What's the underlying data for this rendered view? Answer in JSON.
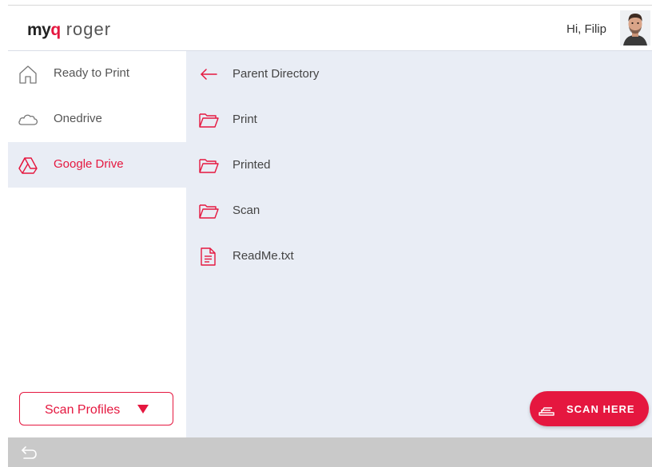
{
  "header": {
    "logo_myq": "myq",
    "logo_roger": "roger",
    "greeting": "Hi, Filip"
  },
  "sidebar": {
    "items": [
      {
        "label": "Ready to Print",
        "icon": "home-icon",
        "active": false
      },
      {
        "label": "Onedrive",
        "icon": "cloud-icon",
        "active": false
      },
      {
        "label": "Google Drive",
        "icon": "google-drive-icon",
        "active": true
      }
    ],
    "scan_profiles_label": "Scan Profiles"
  },
  "content": {
    "rows": [
      {
        "label": "Parent Directory",
        "icon": "arrow-left-icon"
      },
      {
        "label": "Print",
        "icon": "folder-icon"
      },
      {
        "label": "Printed",
        "icon": "folder-icon"
      },
      {
        "label": "Scan",
        "icon": "folder-icon"
      },
      {
        "label": "ReadMe.txt",
        "icon": "file-icon"
      }
    ]
  },
  "scan_button": {
    "label": "SCAN HERE",
    "icon": "scanner-icon"
  },
  "colors": {
    "accent": "#e5173f",
    "content_bg": "#e9edf5",
    "bottom_bar": "#c9c9c9"
  }
}
